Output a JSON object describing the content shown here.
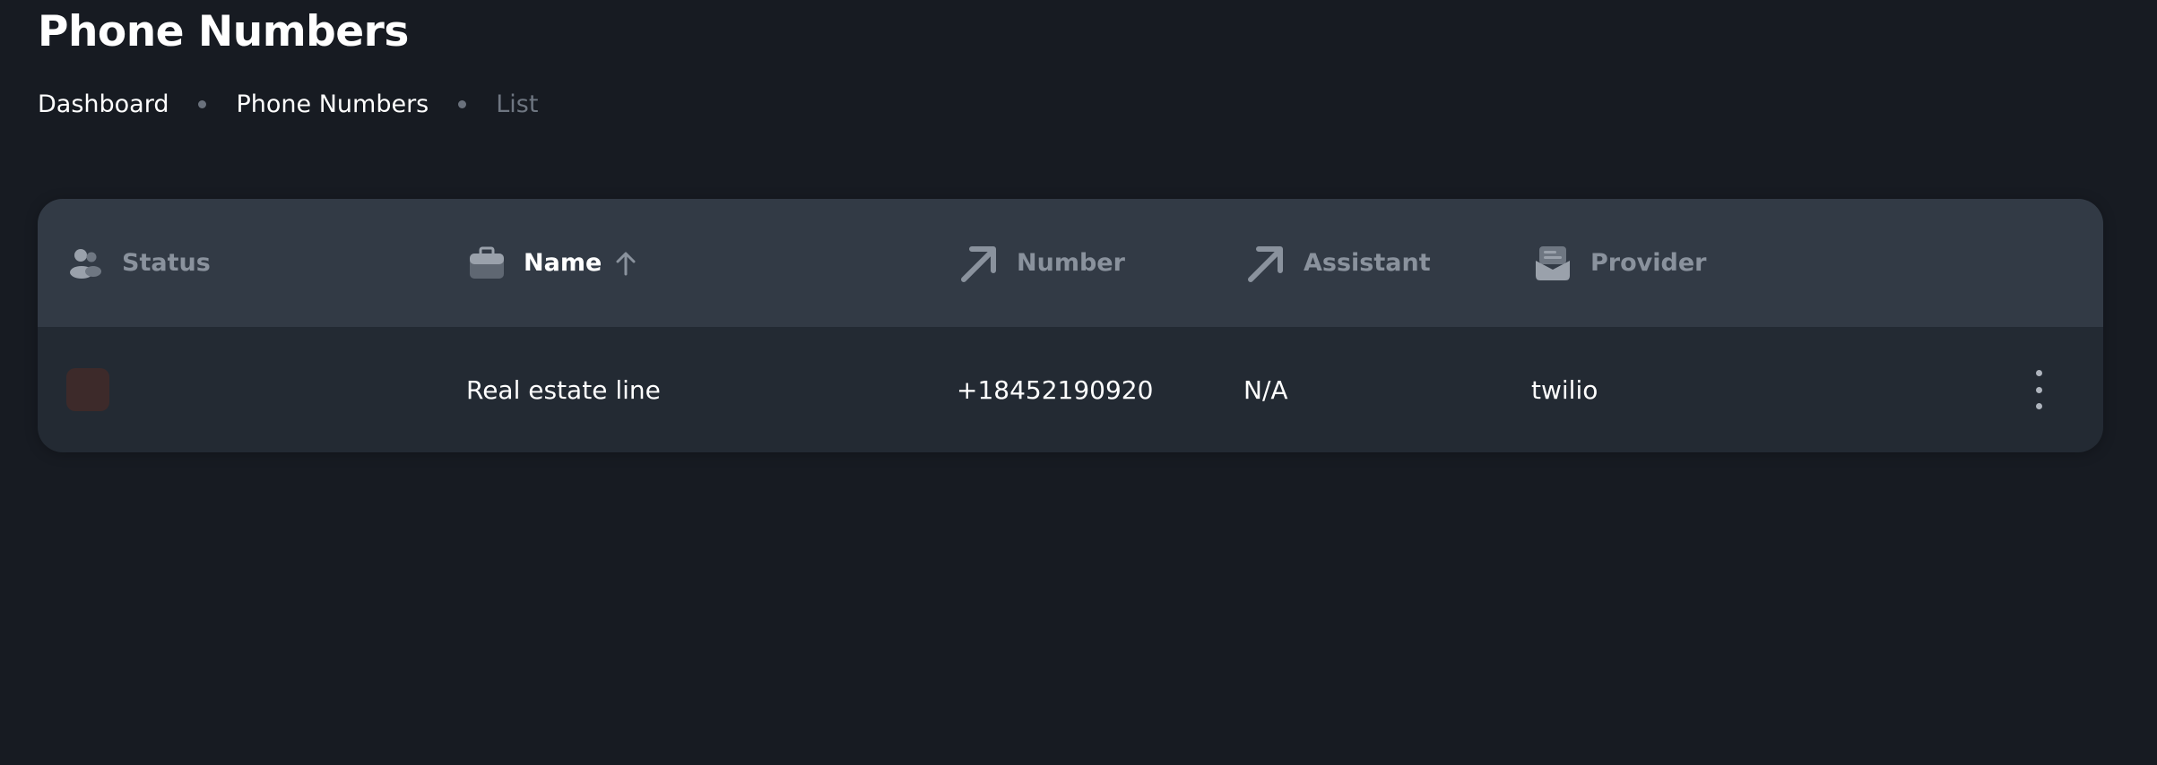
{
  "page": {
    "title": "Phone Numbers"
  },
  "breadcrumb": {
    "items": [
      "Dashboard",
      "Phone Numbers",
      "List"
    ]
  },
  "table": {
    "columns": [
      {
        "label": "Status",
        "icon": "users-icon"
      },
      {
        "label": "Name",
        "icon": "briefcase-icon",
        "sorted": "ascending"
      },
      {
        "label": "Number",
        "icon": "arrow-up-right-icon"
      },
      {
        "label": "Assistant",
        "icon": "arrow-up-right-icon"
      },
      {
        "label": "Provider",
        "icon": "inbox-icon"
      }
    ],
    "rows": [
      {
        "status": "",
        "name": "Real estate line",
        "number": "+18452190920",
        "assistant": "N/A",
        "provider": "twilio"
      }
    ]
  },
  "colors": {
    "background": "#171b22",
    "card": "#232a33",
    "header": "#323a45",
    "muted_text": "#8a929d",
    "status_swatch": "#3d2a2a"
  }
}
